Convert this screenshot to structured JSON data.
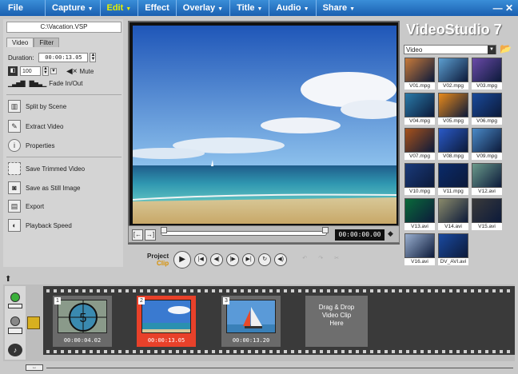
{
  "menubar": {
    "file": "File",
    "items": [
      {
        "label": "Capture",
        "active": false
      },
      {
        "label": "Edit",
        "active": true
      },
      {
        "label": "Effect",
        "active": false
      },
      {
        "label": "Overlay",
        "active": false
      },
      {
        "label": "Title",
        "active": false
      },
      {
        "label": "Audio",
        "active": false
      },
      {
        "label": "Share",
        "active": false
      }
    ],
    "window_controls": "— ✕"
  },
  "left_panel": {
    "path": "C:\\Vacation.VSP",
    "tabs": [
      "Video",
      "Filter"
    ],
    "duration_label": "Duration:",
    "duration_value": "00:00:13.05",
    "volume_value": "100",
    "mute_label": "Mute",
    "fade_label": "Fade In/Out",
    "actions": {
      "split": "Split by Scene",
      "extract": "Extract Video",
      "properties": "Properties",
      "save_trimmed": "Save Trimmed Video",
      "save_still": "Save as Still Image",
      "export": "Export",
      "playback_speed": "Playback Speed"
    }
  },
  "preview": {
    "timecode": "00:00:00.00",
    "project_label": "Project",
    "clip_label": "Clip"
  },
  "library": {
    "brand": "VideoStudio 7",
    "category": "Video",
    "thumbnails": [
      {
        "label": "V01.mpg",
        "color": "#c87a3a"
      },
      {
        "label": "V02.mpg",
        "color": "#5c9ed0"
      },
      {
        "label": "V03.mpg",
        "color": "#6a4aa8"
      },
      {
        "label": "V04.mpg",
        "color": "#2a7aa8"
      },
      {
        "label": "V05.mpg",
        "color": "#e88a1a"
      },
      {
        "label": "V06.mpg",
        "color": "#1a4a9a"
      },
      {
        "label": "V07.mpg",
        "color": "#a8521a"
      },
      {
        "label": "V08.mpg",
        "color": "#2a5ac8"
      },
      {
        "label": "V09.mpg",
        "color": "#4a8ac8"
      },
      {
        "label": "V10.mpg",
        "color": "#1a3a7a"
      },
      {
        "label": "V11.mpg",
        "color": "#0a2a6a"
      },
      {
        "label": "V12.avi",
        "color": "#6a9a8a"
      },
      {
        "label": "V13.avi",
        "color": "#0a6a3a"
      },
      {
        "label": "V14.avi",
        "color": "#8a8a6a"
      },
      {
        "label": "V15.avi",
        "color": "#3a3a3a"
      },
      {
        "label": "V16.avi",
        "color": "#9ab0d0"
      },
      {
        "label": "DV_AVI.avi",
        "color": "#1a4aa0"
      }
    ]
  },
  "timeline": {
    "clips": [
      {
        "num": "1",
        "time": "00:00:04.02"
      },
      {
        "num": "2",
        "time": "00:00:13.05"
      },
      {
        "num": "3",
        "time": "00:00:13.20"
      }
    ],
    "dropzone": [
      "Drag & Drop",
      "Video Clip",
      "Here"
    ]
  }
}
